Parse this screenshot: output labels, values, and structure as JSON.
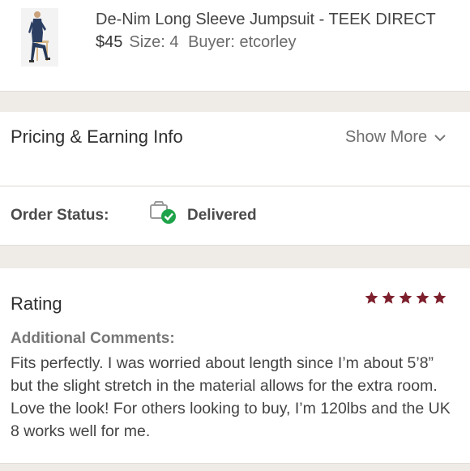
{
  "product": {
    "title": "De-Nim Long Sleeve Jumpsuit - TEEK DIRECT",
    "price": "$45",
    "size": "Size: 4",
    "buyer": "Buyer: etcorley",
    "thumbnail_icon": "product-photo"
  },
  "pricing": {
    "title": "Pricing & Earning Info",
    "show_more": "Show More",
    "chevron_icon": "chevron-down-icon"
  },
  "order": {
    "label": "Order Status:",
    "status": "Delivered",
    "status_icon": "delivered-package-check-icon",
    "status_color": "#1fa34a"
  },
  "rating": {
    "title": "Rating",
    "stars": 5,
    "star_color": "#7d1f2c",
    "comments_label": "Additional Comments:",
    "comments": "Fits perfectly. I was worried about length since I’m about 5’8” but the slight stretch in the material allows for the extra room. Love the look! For others looking to buy, I’m 120lbs and the UK 8 works well for me."
  }
}
